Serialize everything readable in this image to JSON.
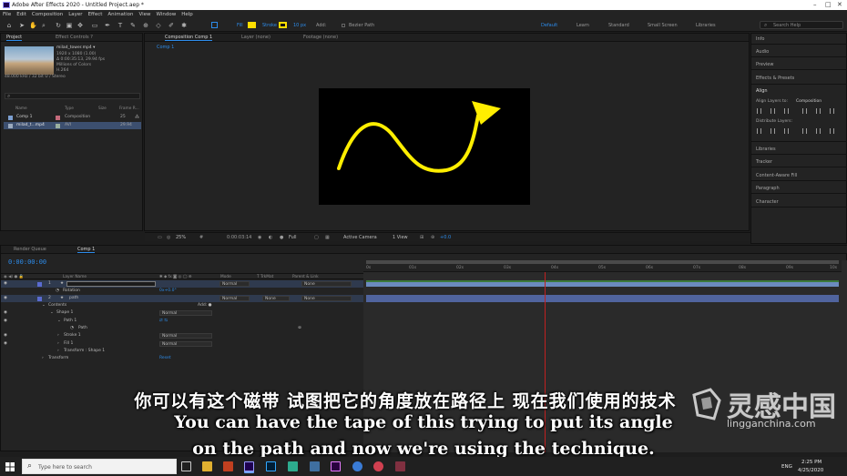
{
  "window": {
    "title": "Adobe After Effects 2020 - Untitled Project.aep *"
  },
  "menu": [
    "File",
    "Edit",
    "Composition",
    "Layer",
    "Effect",
    "Animation",
    "View",
    "Window",
    "Help"
  ],
  "toolbar": {
    "fill_label": "Fill",
    "stroke_label": "Stroke",
    "stroke_width": "10 px",
    "add_label": "Add:",
    "bezier_label": "Bezier Path",
    "workspaces": [
      "Default",
      "Learn",
      "Standard",
      "Small Screen",
      "Libraries"
    ],
    "active_workspace": "Default",
    "search_placeholder": "Search Help",
    "fill_color": "#ffde00",
    "stroke_color": "#ffde00"
  },
  "project_panel": {
    "tabs": [
      "Project",
      "Effect Controls ?"
    ],
    "footage_name": "milad_tower.mp4 ▾",
    "footage_info": [
      "1920 x 1080 (1.00)",
      "Δ 0:00:35:13, 29.94 fps",
      "Millions of Colors",
      "H.264",
      "48.000 kHz / 32 bit U / Stereo"
    ],
    "columns": [
      "Name",
      "Type",
      "Size",
      "Frame R..."
    ],
    "items": [
      {
        "name": "Comp 1",
        "type": "Composition",
        "size": "",
        "fps": "25"
      },
      {
        "name": "milad_t...mp4",
        "type": "AVI",
        "size": "",
        "fps": "29.94"
      }
    ]
  },
  "viewer": {
    "tabs": [
      "Composition Comp 1",
      "Layer (none)",
      "Footage (none)"
    ],
    "comp_tab": "Comp 1",
    "zoom": "25%",
    "timecode": "0:00:03:14",
    "resolution": "Full",
    "camera": "Active Camera",
    "views": "1 View",
    "exposure": "+0.0"
  },
  "right_panel": {
    "items": [
      "Info",
      "Audio",
      "Preview",
      "Effects & Presets",
      "Align",
      "Libraries",
      "Tracker",
      "Content-Aware Fill",
      "Paragraph",
      "Character"
    ],
    "align_to_label": "Align Layers to:",
    "align_to_value": "Composition",
    "distribute_label": "Distribute Layers:"
  },
  "timeline": {
    "tabs": [
      "Render Queue",
      "Comp 1"
    ],
    "timecode": "0:00:00:00",
    "columns": [
      "Layer Name",
      "Mode",
      "T TrkMat",
      "Parent & Link"
    ],
    "layers": [
      {
        "num": "1",
        "name": "",
        "mode": "Normal",
        "trkmat": "",
        "parent": "None"
      },
      {
        "num": "",
        "name": "Rotation",
        "mode": "",
        "trkmat": "",
        "parent": "",
        "value": "0x+0.0°"
      },
      {
        "num": "2",
        "name": "path",
        "mode": "Normal",
        "trkmat": "None",
        "parent": "None"
      },
      {
        "num": "",
        "name": "Contents",
        "mode": "",
        "trkmat": "",
        "parent": "",
        "value": "Add: ●"
      },
      {
        "num": "",
        "name": "Shape 1",
        "mode": "Normal",
        "trkmat": "",
        "parent": ""
      },
      {
        "num": "",
        "name": "Path 1",
        "mode": "",
        "trkmat": "",
        "parent": ""
      },
      {
        "num": "",
        "name": "Path",
        "mode": "",
        "trkmat": "",
        "parent": ""
      },
      {
        "num": "",
        "name": "Stroke 1",
        "mode": "Normal",
        "trkmat": "",
        "parent": ""
      },
      {
        "num": "",
        "name": "Fill 1",
        "mode": "Normal",
        "trkmat": "",
        "parent": ""
      },
      {
        "num": "",
        "name": "Transform : Shape 1",
        "mode": "",
        "trkmat": "",
        "parent": ""
      },
      {
        "num": "",
        "name": "Transform",
        "mode": "",
        "trkmat": "",
        "parent": "",
        "value": "Reset"
      }
    ],
    "ruler_ticks": [
      "0s",
      "01s",
      "02s",
      "03s",
      "04s",
      "05s",
      "06s",
      "07s",
      "08s",
      "09s",
      "10s"
    ]
  },
  "subtitles": {
    "chinese": "你可以有这个磁带 试图把它的角度放在路径上 现在我们使用的技术",
    "english_line1": "You can have the tape of this trying to put its angle",
    "english_line2": "on the path and now we're using the technique."
  },
  "watermark": {
    "cn": "灵感中国",
    "en": "lingganchina.com"
  },
  "taskbar": {
    "search_placeholder": "Type here to search",
    "lang": "ENG",
    "time": "2:25 PM",
    "date": "4/25/2020"
  }
}
